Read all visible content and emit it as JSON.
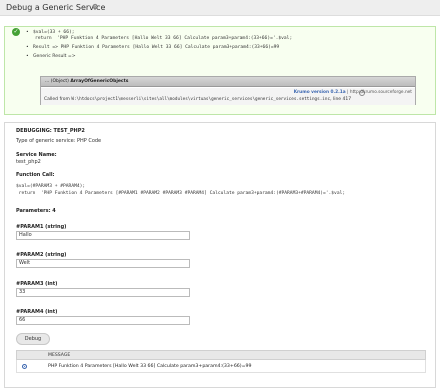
{
  "header": {
    "title": "Debug a Generic Service",
    "settings_icon": "gear-icon"
  },
  "message_box": {
    "status_icon": "check-icon",
    "status_color": "#45a135",
    "lines": [
      "$val=(33 + 66);",
      "return  'PHP Funktion 4 Parameters [Hallo Welt 33 66] Calculate param3+param4:(33+66)='.$val;",
      "Result => PHP Funktion 4 Parameters [Hallo Welt 33 66] Calculate param3+param4:(33+66)=99",
      "Generic Result =>"
    ],
    "krumo": {
      "header_prefix": "... (Object)",
      "header_class": "ArrayOfGenericObjects",
      "version_label": "Krumo version 0.2.1a",
      "version_link": "| http://krumo.sourceforge.net",
      "called_prefix": "Called from",
      "called_path": "W:\\htdocs\\project1\\messerli\\sites\\all\\modules\\virtuas\\generic_services\\generic_services.settings.inc",
      "called_line": ", line 417"
    }
  },
  "form": {
    "debugging_heading": "DEBUGGING: TEST_PHP2",
    "type_label": "Type of generic service: PHP Code",
    "service_name_label": "Service Name:",
    "service_name_value": "test_php2",
    "function_call_label": "Function Call:",
    "code_line1": "$val=(#PARAM3 + #PARAM4);",
    "code_line2": " return  'PHP Funktion 4 Parameters [#PARAM1 #PARAM2 #PARAM3 #PARAM4] Calculate param3+param4:(#PARAM3+#PARAM4)='.$val;",
    "parameters_label": "Parameters: 4",
    "params": [
      {
        "label": "#PARAM1 (string)",
        "value": "Hallo"
      },
      {
        "label": "#PARAM2 (string)",
        "value": "Welt"
      },
      {
        "label": "#PARAM3 (int)",
        "value": "33"
      },
      {
        "label": "#PARAM4 (int)",
        "value": "66"
      }
    ],
    "debug_button": "Debug"
  },
  "results_table": {
    "column_header": "MESSAGE",
    "rows": [
      {
        "message": "PHP Funktion 4 Parameters [Hallo Welt 33 66] Calculate param3+param4:(33+66)=99"
      }
    ]
  }
}
